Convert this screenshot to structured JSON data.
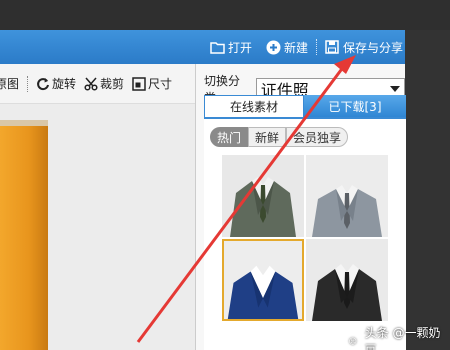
{
  "header": {
    "open_label": "打开",
    "new_label": "新建",
    "save_label": "保存与分享"
  },
  "toolbar": {
    "original_label": "原图",
    "rotate_label": "旋转",
    "crop_label": "裁剪",
    "size_label": "尺寸"
  },
  "panel": {
    "category_label": "切换分类",
    "category_value": "证件照",
    "tabs": [
      {
        "label": "在线素材",
        "active": true
      },
      {
        "label": "已下载[3]",
        "active": false
      }
    ],
    "filters": [
      {
        "label": "热门",
        "active": true
      },
      {
        "label": "新鲜",
        "active": false
      },
      {
        "label": "会员独享",
        "active": false
      }
    ],
    "thumbnails": [
      {
        "name": "gray-suit-green-tie",
        "selected": false
      },
      {
        "name": "light-gray-suit-tie",
        "selected": false
      },
      {
        "name": "navy-suit-white-collar",
        "selected": true
      },
      {
        "name": "black-suit-dotted-tie",
        "selected": false
      }
    ]
  },
  "watermark": {
    "text": "头条 @一颗奶豆"
  },
  "colors": {
    "titlebar": "#2b7bc8",
    "tab_active_border": "#3a8ad4",
    "selection": "#e4a92d",
    "arrow": "#e53935"
  }
}
